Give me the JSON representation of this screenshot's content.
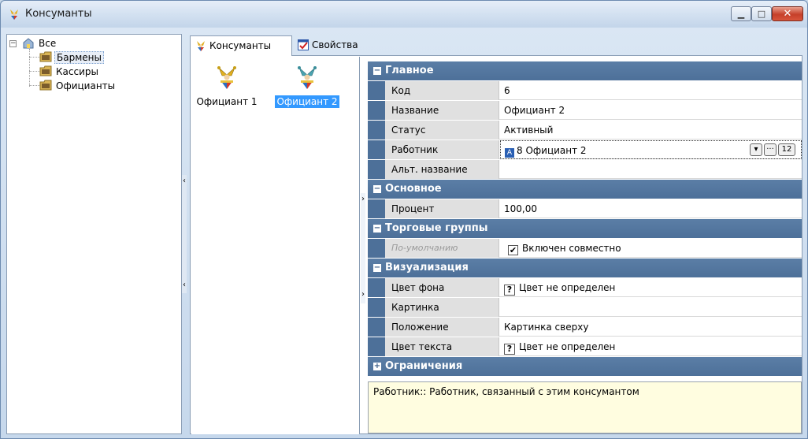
{
  "window": {
    "title": "Консуманты",
    "controls": {
      "minimize": "▁",
      "maximize": "□",
      "close": "✕"
    }
  },
  "tree": {
    "root": "Все",
    "items": [
      {
        "label": "Бармены",
        "selected": true
      },
      {
        "label": "Кассиры",
        "selected": false
      },
      {
        "label": "Официанты",
        "selected": false
      }
    ]
  },
  "tabs": [
    {
      "label": "Консуманты",
      "icon": "jester-icon",
      "active": true
    },
    {
      "label": "Свойства",
      "icon": "properties-icon",
      "active": false
    }
  ],
  "consumants": [
    {
      "label": "Официант 1",
      "selected": false
    },
    {
      "label": "Официант 2",
      "selected": true
    }
  ],
  "properties": {
    "main": {
      "title": "Главное",
      "rows": [
        {
          "name": "Код",
          "value": "6"
        },
        {
          "name": "Название",
          "value": "Официант 2"
        },
        {
          "name": "Статус",
          "value": "Активный"
        },
        {
          "name": "Работник",
          "value": "8 Официант 2",
          "badge": "12"
        },
        {
          "name": "Альт. название",
          "value": ""
        }
      ]
    },
    "basic": {
      "title": "Основное",
      "rows": [
        {
          "name": "Процент",
          "value": "100,00"
        }
      ]
    },
    "trade": {
      "title": "Торговые группы",
      "rows": [
        {
          "name": "По-умолчанию",
          "value": "Включен совместно"
        }
      ]
    },
    "visual": {
      "title": "Визуализация",
      "rows": [
        {
          "name": "Цвет фона",
          "value": "Цвет не определен"
        },
        {
          "name": "Картинка",
          "value": ""
        },
        {
          "name": "Положение",
          "value": "Картинка сверху"
        },
        {
          "name": "Цвет текста",
          "value": "Цвет не определен"
        }
      ]
    },
    "limits": {
      "title": "Ограничения"
    }
  },
  "description": "Работник:: Работник, связанный с этим консумантом",
  "colors": {
    "category_header": "#4d7099",
    "selection": "#3399ff",
    "description_bg": "#fffde0"
  }
}
